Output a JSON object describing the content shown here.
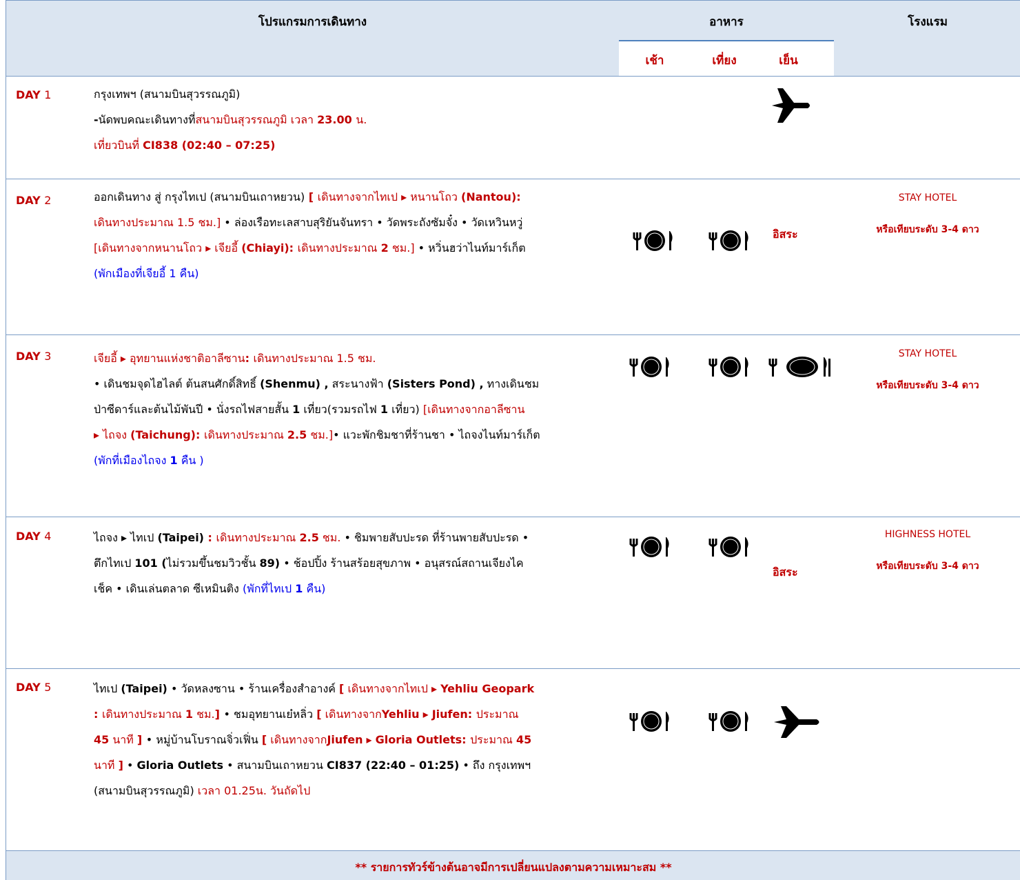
{
  "header": {
    "program": "โปรแกรมการเดินทาง",
    "meals": "อาหาร",
    "hotel": "โรงแรม",
    "breakfast": "เช้า",
    "lunch": "เที่ยง",
    "dinner": "เย็น"
  },
  "days": [
    {
      "day_label": "DAY",
      "day_num": "1",
      "lines": [
        [
          {
            "t": "กรุงเทพฯ  (สนามบินสุวรรณภูมิ)",
            "c": ""
          }
        ],
        [
          {
            "t": "-",
            "c": "b"
          },
          {
            "t": "นัดพบคณะเดินทางที่",
            "c": ""
          },
          {
            "t": "สนามบินสุวรรณภูมิ เวลา ",
            "c": "red"
          },
          {
            "t": "23.00 ",
            "c": "red b"
          },
          {
            "t": "น.",
            "c": "red"
          }
        ],
        [
          {
            "t": "เที่ยวบินที่ ",
            "c": "red"
          },
          {
            "t": "CI838 (02:40 – 07:25)",
            "c": "red b"
          }
        ]
      ],
      "meals": {
        "breakfast": "",
        "lunch": "",
        "dinner": "plane-icon"
      },
      "hotel_name": "",
      "hotel_note": ""
    },
    {
      "day_label": "DAY",
      "day_num": "2",
      "lines": [
        [
          {
            "t": "ออกเดินทาง สู่ กรุงไทเป (สนามบินเถาหยวน)",
            "c": ""
          },
          {
            "t": " [ ",
            "c": "red b"
          },
          {
            "t": "เดินทางจากไทเป ▸ หนานโถว ",
            "c": "red"
          },
          {
            "t": "(Nantou):",
            "c": "red b"
          }
        ],
        [
          {
            "t": "เดินทางประมาณ 1.5 ชม.]  ",
            "c": "red"
          },
          {
            "t": "• ล่องเรือทะเลสาบสุริยันจันทรา  • วัดพระถังซัมจั๋ง • วัดเหวินหวู่",
            "c": ""
          }
        ],
        [
          {
            "t": "[เดินทางจากหนานโถว ▸ เจียอี้ ",
            "c": "red"
          },
          {
            "t": "(Chiayi): ",
            "c": "red b"
          },
          {
            "t": "เดินทางประมาณ ",
            "c": "red"
          },
          {
            "t": "2",
            "c": "red b"
          },
          {
            "t": " ชม.]  ",
            "c": "red"
          },
          {
            "t": "• หวิ่นฮว่าไนท์มาร์เก็ต",
            "c": ""
          }
        ],
        [
          {
            "t": "(พักเมืองที่เจียอี้ 1 คืน)",
            "c": "blue"
          }
        ]
      ],
      "meals": {
        "breakfast": "plate-icon",
        "lunch": "plate-icon",
        "dinner": "อิสระ"
      },
      "hotel_name": "STAY HOTEL",
      "hotel_note": "หรือเทียบระดับ 3-4 ดาว"
    },
    {
      "day_label": "DAY",
      "day_num": "3",
      "lines": [
        [
          {
            "t": "เจียอี้ ▸ อุทยานแห่งชาติอาลีซาน",
            "c": "red"
          },
          {
            "t": ": ",
            "c": "red b"
          },
          {
            "t": "เดินทางประมาณ 1.5 ชม.",
            "c": "red"
          }
        ],
        [
          {
            "t": "  • เดินชมจุดไฮไลต์  ต้นสนศักดิ์สิทธิ์ ",
            "c": ""
          },
          {
            "t": "(Shenmu) ,",
            "c": "b"
          },
          {
            "t": " สระนางฟ้า ",
            "c": ""
          },
          {
            "t": "(Sisters Pond) ,",
            "c": "b"
          },
          {
            "t": " ทางเดินชม",
            "c": ""
          }
        ],
        [
          {
            "t": "ป่าซีดาร์และต้นไม้พันปี  • นั่งรถไฟสายสั้น ",
            "c": ""
          },
          {
            "t": "1",
            "c": "b"
          },
          {
            "t": " เที่ยว(รวมรถไฟ ",
            "c": ""
          },
          {
            "t": "1",
            "c": "b"
          },
          {
            "t": " เที่ยว) ",
            "c": ""
          },
          {
            "t": "[เดินทางจากอาลีซาน",
            "c": "red"
          }
        ],
        [
          {
            "t": "▸ ไถจง ",
            "c": "red"
          },
          {
            "t": "(Taichung): ",
            "c": "red b"
          },
          {
            "t": "เดินทางประมาณ ",
            "c": "red"
          },
          {
            "t": "2.5",
            "c": "red b"
          },
          {
            "t": " ชม.]",
            "c": "red"
          },
          {
            "t": "• แวะพักชิมชาที่ร้านชา • ไถจงไนท์มาร์เก็ต",
            "c": ""
          }
        ],
        [
          {
            "t": "(พักที่เมืองไถจง ",
            "c": "blue"
          },
          {
            "t": "1",
            "c": "blue b"
          },
          {
            "t": " คืน )",
            "c": "blue"
          }
        ]
      ],
      "meals": {
        "breakfast": "plate-icon",
        "lunch": "plate-icon",
        "dinner": "plate-icon"
      },
      "hotel_name": "STAY HOTEL",
      "hotel_note": "หรือเทียบระดับ 3-4 ดาว"
    },
    {
      "day_label": "DAY",
      "day_num": "4",
      "lines": [
        [
          {
            "t": "ไถจง ▸ ไทเป ",
            "c": ""
          },
          {
            "t": "(Taipei)",
            "c": "b"
          },
          {
            "t": " : ",
            "c": "red b"
          },
          {
            "t": "เดินทางประมาณ ",
            "c": "red"
          },
          {
            "t": "2.5",
            "c": "red b"
          },
          {
            "t": " ชม.",
            "c": "red"
          },
          {
            "t": " • ชิมพายสับปะรด ที่ร้านพายสับปะรด •",
            "c": ""
          }
        ],
        [
          {
            "t": "ตึกไทเป ",
            "c": ""
          },
          {
            "t": "101 (",
            "c": "b"
          },
          {
            "t": "ไม่รวมขึ้นชมวิวชั้น ",
            "c": ""
          },
          {
            "t": "89)",
            "c": "b"
          },
          {
            "t": " • ช้อปปิ้ง ร้านสร้อยสุขภาพ •  อนุสรณ์สถานเจียงไค",
            "c": ""
          }
        ],
        [
          {
            "t": "เช็ค • เดินเล่นตลาด ซีเหมินติง ",
            "c": ""
          },
          {
            "t": "(พักที่ไทเป ",
            "c": "blue"
          },
          {
            "t": "1",
            "c": "blue b"
          },
          {
            "t": " คืน)",
            "c": "blue"
          }
        ]
      ],
      "meals": {
        "breakfast": "plate-icon",
        "lunch": "plate-icon",
        "dinner": "อิสระ"
      },
      "hotel_name": "HIGHNESS HOTEL",
      "hotel_note": "หรือเทียบระดับ 3-4 ดาว"
    },
    {
      "day_label": "DAY",
      "day_num": "5",
      "lines": [
        [
          {
            "t": "ไทเป ",
            "c": ""
          },
          {
            "t": "(Taipei)",
            "c": "b"
          },
          {
            "t": " •  วัดหลงซาน  • ร้านเครื่องสำอางค์ ",
            "c": ""
          },
          {
            "t": "[",
            "c": "red b"
          },
          {
            "t": " เดินทางจากไทเป ▸ ",
            "c": "red"
          },
          {
            "t": "Yehliu Geopark",
            "c": "red b"
          }
        ],
        [
          {
            "t": ": ",
            "c": "red b"
          },
          {
            "t": "เดินทางประมาณ ",
            "c": "red"
          },
          {
            "t": "1",
            "c": "red b"
          },
          {
            "t": " ชม.",
            "c": "red"
          },
          {
            "t": "] ",
            "c": "red b"
          },
          {
            "t": "• ชมอุทยานเย๋หลิ่ว  ",
            "c": ""
          },
          {
            "t": "[",
            "c": "red b"
          },
          {
            "t": " เดินทางจาก",
            "c": "red"
          },
          {
            "t": "Yehliu",
            "c": "red b"
          },
          {
            "t": "  ▸  ",
            "c": "red"
          },
          {
            "t": "Jiufen: ",
            "c": "red b"
          },
          {
            "t": "ประมาณ",
            "c": "red"
          }
        ],
        [
          {
            "t": "45",
            "c": "red b"
          },
          {
            "t": " นาที ",
            "c": "red"
          },
          {
            "t": "] ",
            "c": "red b"
          },
          {
            "t": "• หมู่บ้านโบราณจิ่วเฟิ่น  ",
            "c": ""
          },
          {
            "t": "[",
            "c": "red b"
          },
          {
            "t": " เดินทางจาก",
            "c": "red"
          },
          {
            "t": "Jiufen",
            "c": "red b"
          },
          {
            "t": "  ▸  ",
            "c": "red"
          },
          {
            "t": "Gloria Outlets: ",
            "c": "red b"
          },
          {
            "t": "ประมาณ ",
            "c": "red"
          },
          {
            "t": "45",
            "c": "red b"
          }
        ],
        [
          {
            "t": "นาที ",
            "c": "red"
          },
          {
            "t": "]",
            "c": "red b"
          },
          {
            "t": "  • ",
            "c": ""
          },
          {
            "t": "Gloria Outlets",
            "c": "b"
          },
          {
            "t": "  • สนามบินเถาหยวน ",
            "c": ""
          },
          {
            "t": "CI837 (22:40 – 01:25)",
            "c": "b"
          },
          {
            "t": "  • ถึง กรุงเทพฯ",
            "c": ""
          }
        ],
        [
          {
            "t": "(สนามบินสุวรรณภูมิ) ",
            "c": ""
          },
          {
            "t": "เวลา 01.25น. วันถัดไป",
            "c": "red"
          }
        ]
      ],
      "meals": {
        "breakfast": "plate-icon",
        "lunch": "plate-icon",
        "dinner": "plane-icon"
      },
      "hotel_name": "",
      "hotel_note": ""
    }
  ],
  "footer": "** รายการทัวร์ข้างต้นอาจมีการเปลี่ยนแปลงตามความเหมาะสม **",
  "colors": {
    "accent_red": "#c00000",
    "note_blue": "#0000ee",
    "header_bg": "#dbe5f1"
  }
}
